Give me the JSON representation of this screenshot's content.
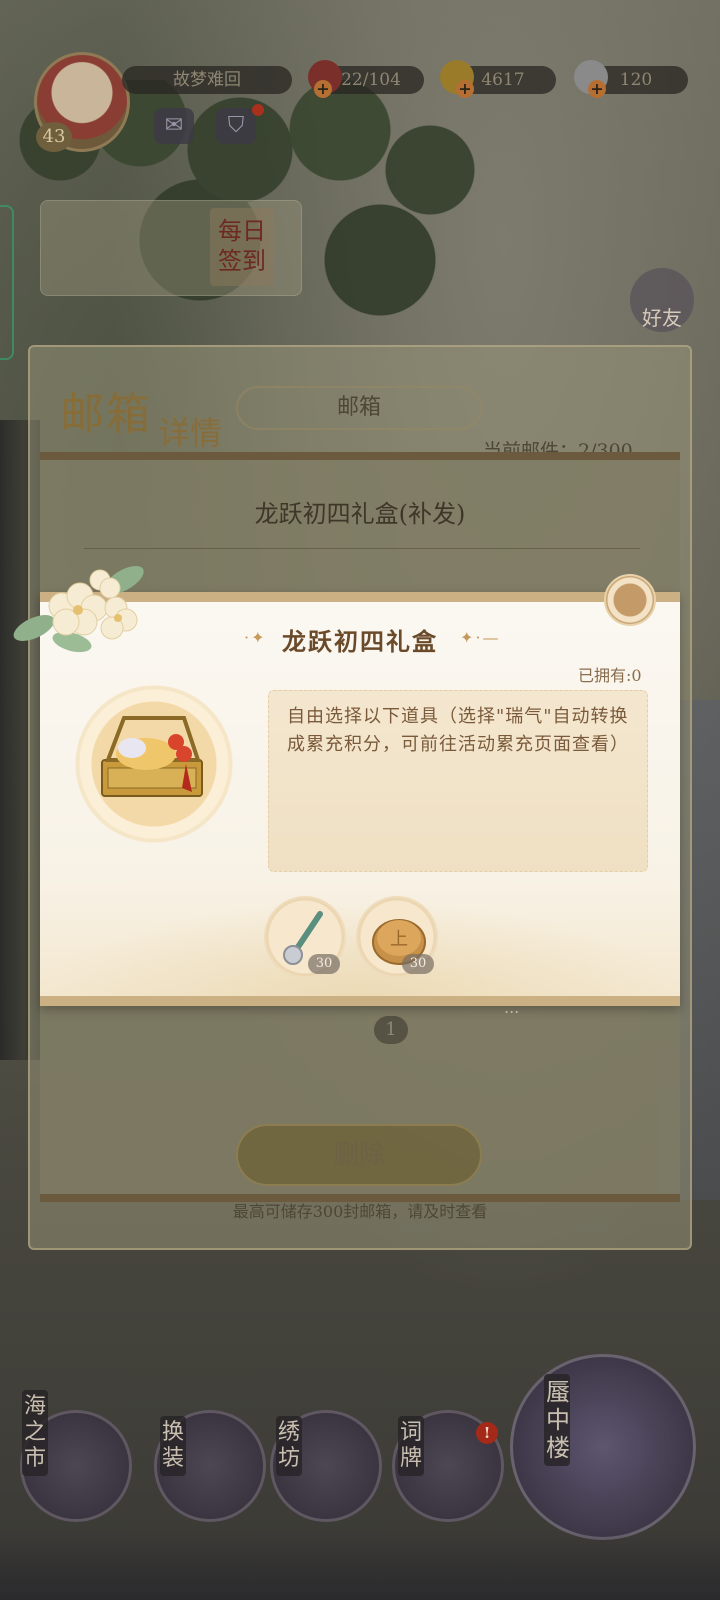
{
  "topbar": {
    "level": "43",
    "name": "故梦难回",
    "resources": [
      {
        "id": "stamina",
        "value": "22/104"
      },
      {
        "id": "gold",
        "value": "4617"
      },
      {
        "id": "pearl",
        "value": "120"
      }
    ]
  },
  "daily": {
    "label": "每日签到"
  },
  "friends": {
    "label": "好友"
  },
  "mailbox": {
    "title_big": "邮箱",
    "title_sub": "详情",
    "tab_label": "邮箱",
    "count_label": "当前邮件：2/300",
    "detail_title": "龙跃初四礼盒(补发)",
    "attachment_count": "1",
    "delete_label": "删除",
    "note": "最高可储存300封邮箱，请及时查看",
    "more": "..."
  },
  "popup": {
    "title": "龙跃初四礼盒",
    "owned": "已拥有:0",
    "description": "自由选择以下道具（选择\"瑞气\"自动转换成累充积分，可前往活动累充页面查看）",
    "rewards": [
      {
        "icon": "silver-hairpin-icon",
        "count": "30"
      },
      {
        "icon": "gold-coin-icon",
        "count": "30"
      }
    ]
  },
  "nav": {
    "items": [
      {
        "id": "sea-market",
        "label": "海之市"
      },
      {
        "id": "dress",
        "label": "换装"
      },
      {
        "id": "embroidery",
        "label": "绣坊"
      },
      {
        "id": "lyrics",
        "label": "词牌"
      },
      {
        "id": "tower",
        "label": "蜃中楼"
      }
    ],
    "alert": "!"
  },
  "colors": {
    "popup_border": "#cbb084",
    "title_brown": "#6b4a2a",
    "desc_text": "#7a5a3a",
    "alert_red": "#a52918"
  }
}
